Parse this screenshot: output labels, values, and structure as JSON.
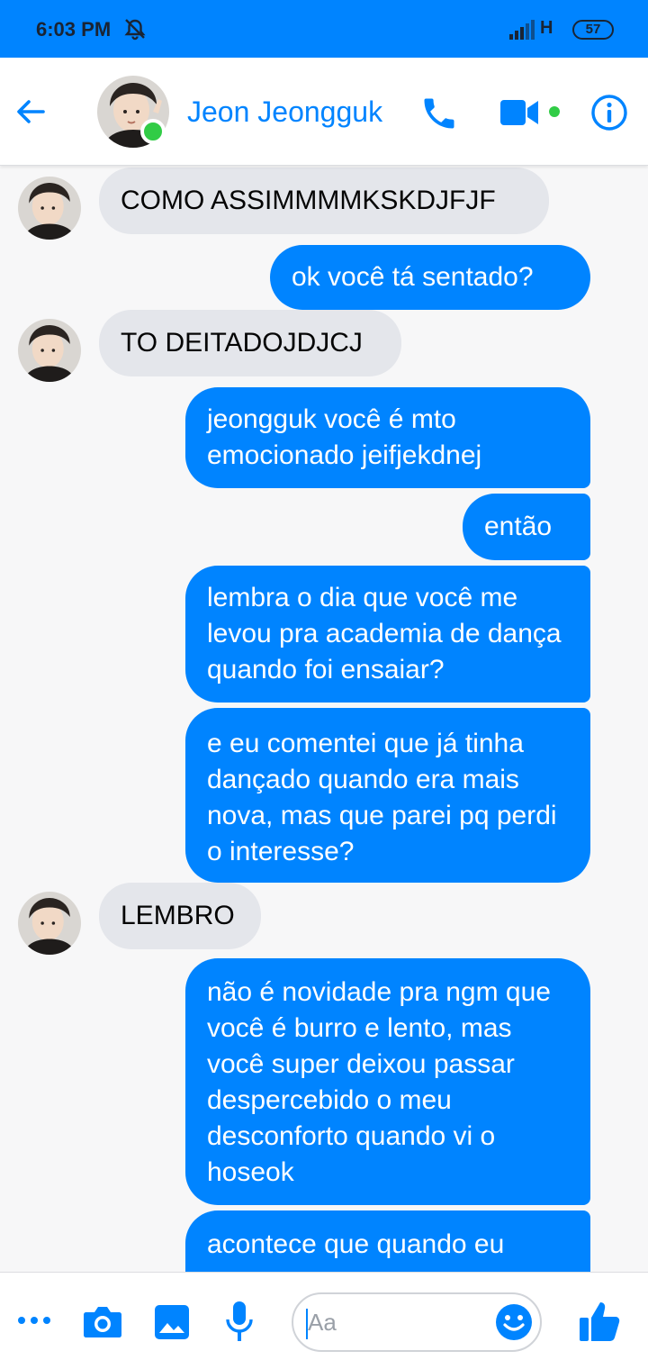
{
  "status_bar": {
    "time": "6:03 PM",
    "network": "H",
    "battery": "57"
  },
  "header": {
    "contact_name": "Jeon Jeongguk"
  },
  "messages": [
    {
      "side": "in",
      "text": "COMO ASSIMMMMKSKDJFJF",
      "avatar": true
    },
    {
      "side": "out",
      "text": "ok você tá sentado?"
    },
    {
      "side": "in",
      "text": "TO DEITADOJDJCJ",
      "avatar": true
    },
    {
      "side": "out",
      "text": "jeongguk você é mto emocionado jeifjekdnej"
    },
    {
      "side": "out",
      "text": "então"
    },
    {
      "side": "out",
      "text": "lembra o dia que você me levou pra academia de dança quando foi ensaiar?"
    },
    {
      "side": "out",
      "text": "e eu comentei que já tinha dançado quando era mais nova, mas que parei pq perdi o interesse?"
    },
    {
      "side": "in",
      "text": "LEMBRO",
      "avatar": true
    },
    {
      "side": "out",
      "text": "não é novidade pra ngm que você é burro e lento, mas você super deixou passar despercebido o meu desconforto quando vi o hoseok"
    },
    {
      "side": "out",
      "text": "acontece que quando eu"
    }
  ],
  "composer": {
    "placeholder": "Aa"
  },
  "colors": {
    "accent": "#0084ff",
    "online": "#31cc46",
    "incoming_bubble": "#e4e6eb"
  },
  "icons": [
    "back-arrow-icon",
    "phone-icon",
    "video-camera-icon",
    "info-icon",
    "more-dots-icon",
    "camera-icon",
    "gallery-icon",
    "microphone-icon",
    "emoji-icon",
    "thumbs-up-icon"
  ]
}
